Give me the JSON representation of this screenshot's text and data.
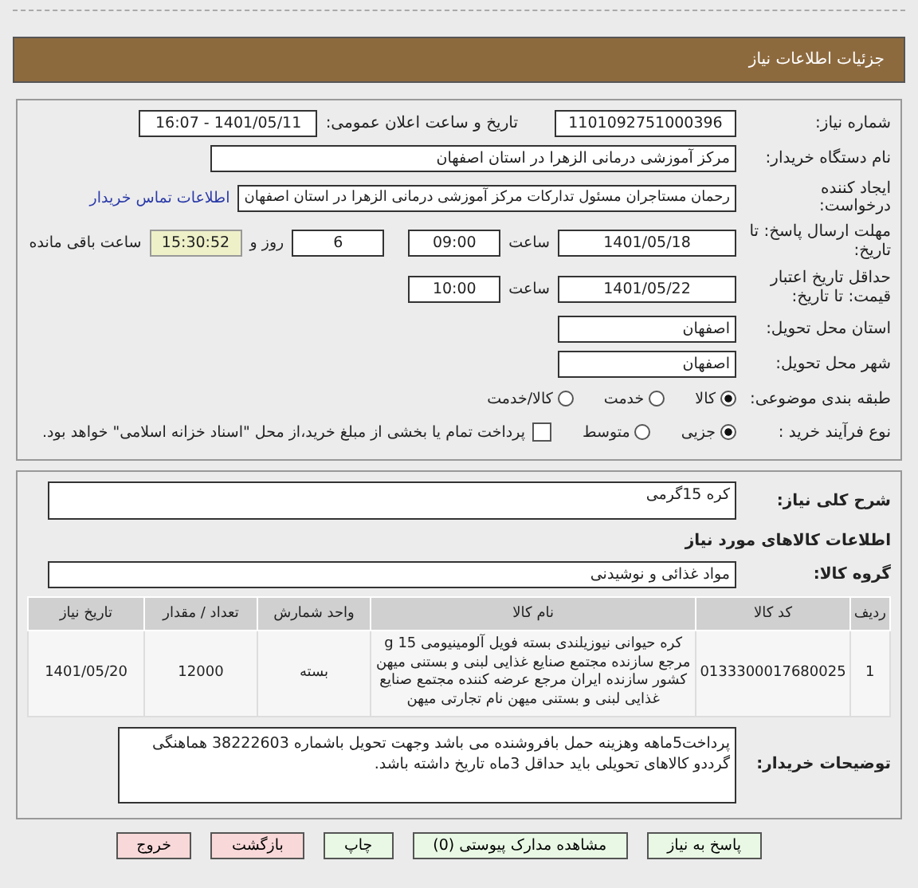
{
  "header": {
    "title": "جزئیات اطلاعات نیاز"
  },
  "need_number": {
    "label": "شماره نیاز:",
    "value": "1101092751000396"
  },
  "announce": {
    "label": "تاریخ و ساعت اعلان عمومی:",
    "value": "1401/05/11 - 16:07"
  },
  "buyer": {
    "label": "نام دستگاه خریدار:",
    "value": "مرکز آموزشی درمانی الزهرا در استان اصفهان"
  },
  "creator": {
    "label": "ایجاد کننده درخواست:",
    "value": "رحمان مستاجران مسئول تداركات مرکز آموزشی درمانی الزهرا در استان اصفهان",
    "link": "اطلاعات تماس خریدار"
  },
  "deadline": {
    "label": "مهلت ارسال پاسخ: تا تاریخ:",
    "date": "1401/05/18",
    "time_label": "ساعت",
    "time": "09:00",
    "days": "6",
    "days_label": "روز و",
    "remaining": "15:30:52",
    "remaining_label": "ساعت باقی مانده"
  },
  "validity": {
    "label": "حداقل تاریخ اعتبار قیمت: تا تاریخ:",
    "date": "1401/05/22",
    "time_label": "ساعت",
    "time": "10:00"
  },
  "province": {
    "label": "استان محل تحویل:",
    "value": "اصفهان"
  },
  "city": {
    "label": "شهر محل تحویل:",
    "value": "اصفهان"
  },
  "category": {
    "label": "طبقه بندی موضوعی:",
    "options": [
      {
        "label": "کالا",
        "selected": true
      },
      {
        "label": "خدمت",
        "selected": false
      },
      {
        "label": "کالا/خدمت",
        "selected": false
      }
    ]
  },
  "process": {
    "label": "نوع فرآیند خرید :",
    "options": [
      {
        "label": "جزیی",
        "selected": true
      },
      {
        "label": "متوسط",
        "selected": false
      }
    ],
    "treasury": {
      "label": "پرداخت تمام یا بخشی از مبلغ خرید،از محل \"اسناد خزانه اسلامی\" خواهد بود.",
      "checked": false
    }
  },
  "summary": {
    "label": "شرح کلی نیاز:",
    "value": "کره 15گرمی"
  },
  "goods_title": "اطلاعات کالاهای مورد نیاز",
  "goods_group": {
    "label": "گروه کالا:",
    "value": "مواد غذائی و نوشیدنی"
  },
  "table": {
    "columns": [
      "ردیف",
      "کد کالا",
      "نام کالا",
      "واحد شمارش",
      "تعداد / مقدار",
      "تاریخ نیاز"
    ],
    "rows": [
      [
        "1",
        "0133300017680025",
        "کره حیوانی نیوزیلندی بسته فویل آلومینیومی 15 g مرجع سازنده مجتمع صنایع غذایی لبنی و بستنی میهن کشور سازنده ایران مرجع عرضه کننده مجتمع صنایع غذایی لبنی و بستنی میهن نام تجارتی میهن",
        "بسته",
        "12000",
        "1401/05/20"
      ]
    ]
  },
  "notes": {
    "label": "توضیحات خریدار:",
    "value": "پرداخت5ماهه وهزینه حمل بافروشنده می باشد وجهت تحویل باشماره 38222603 هماهنگی گرددو کالاهای تحویلی باید حداقل 3ماه تاریخ داشته باشد."
  },
  "buttons": [
    {
      "label": "پاسخ به نیاز",
      "kind": "primary"
    },
    {
      "label": "مشاهده مدارک پیوستی (0)",
      "kind": "primary"
    },
    {
      "label": "چاپ",
      "kind": "primary"
    },
    {
      "label": "بازگشت",
      "kind": "danger"
    },
    {
      "label": "خروج",
      "kind": "danger"
    }
  ]
}
